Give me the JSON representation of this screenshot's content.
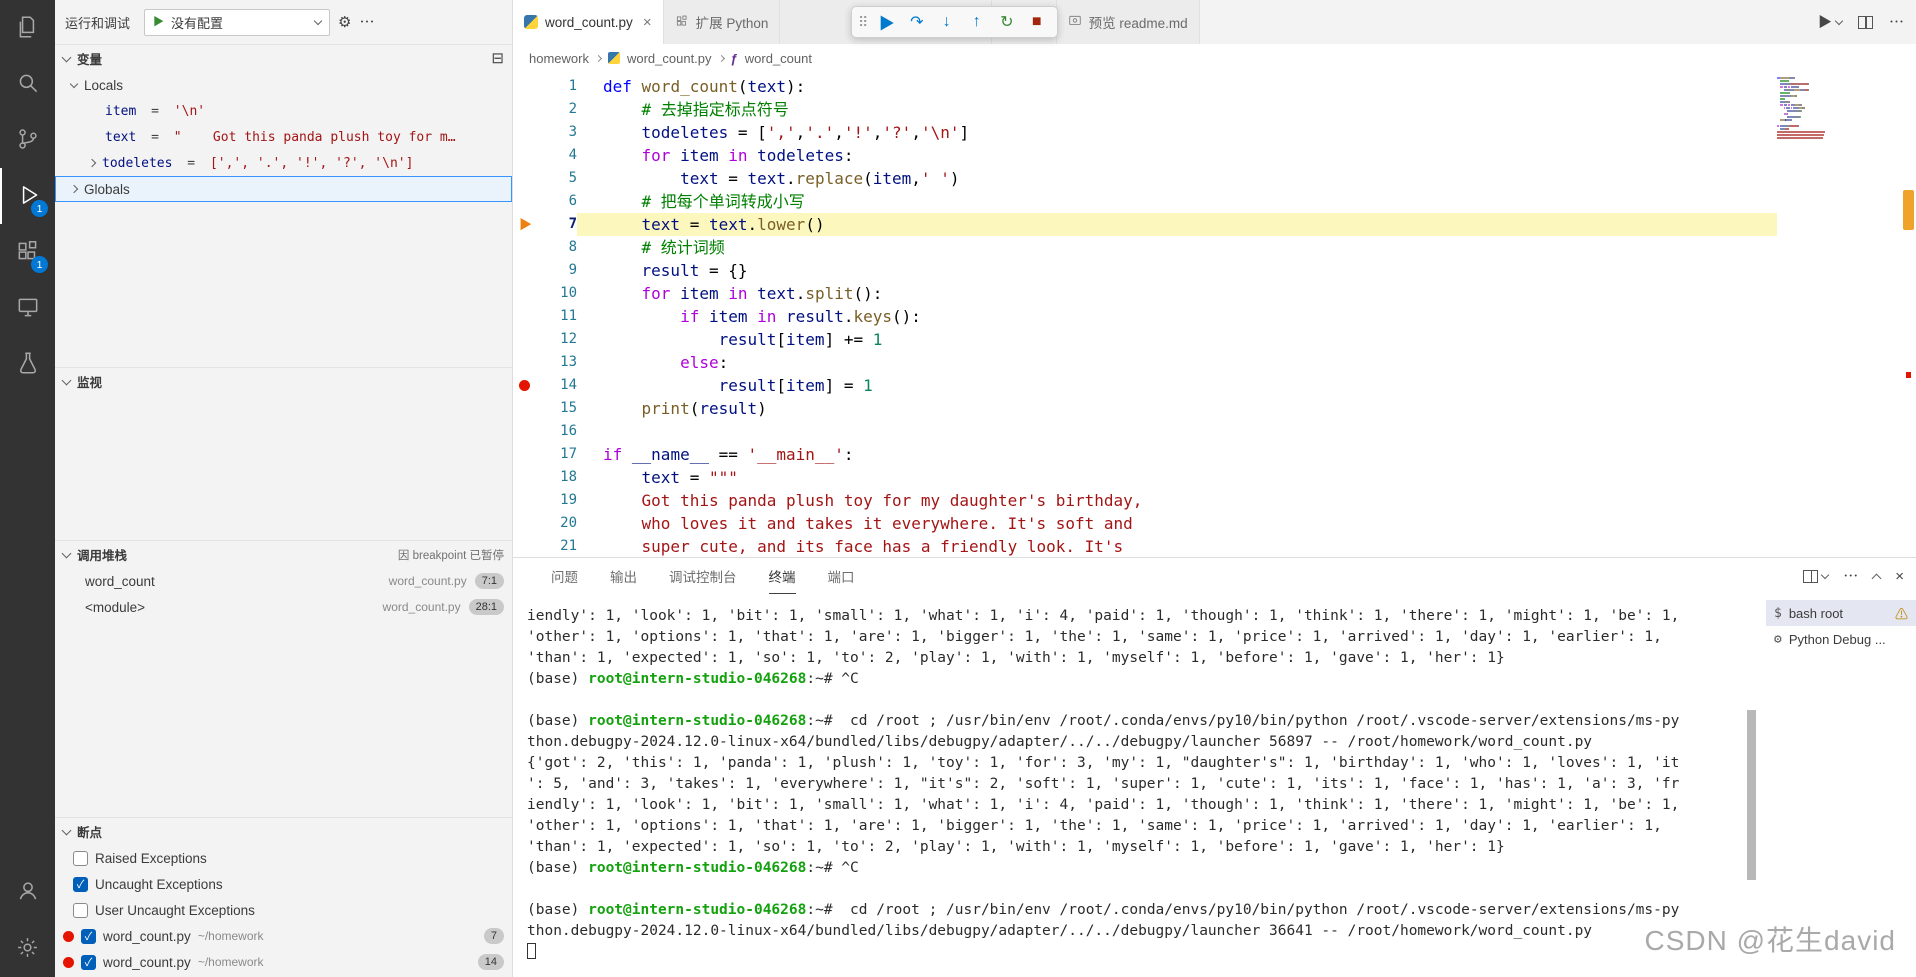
{
  "glyphs": {
    "run": "▶",
    "gear": "⚙",
    "more": "⋯",
    "close": "×",
    "check": "✓",
    "warning": "⚠",
    "grip": "⠿",
    "continue": "▶",
    "step_over": "↷",
    "step_into": "↓",
    "step_out": "↑",
    "restart": "↻",
    "stop": "■",
    "collapse": "⊟",
    "func": "ƒ",
    "dollar": "$"
  },
  "colors": {
    "accent_blue": "#0078d4",
    "breakpoint_red": "#e51400",
    "current_line_yellow": "#fcf8bd",
    "terminal_green": "#13a10e",
    "activity_bar_bg": "#333333",
    "sidebar_bg": "#f3f3f3"
  },
  "activity_bar": {
    "items": [
      {
        "id": "explorer"
      },
      {
        "id": "search"
      },
      {
        "id": "source-control"
      },
      {
        "id": "run-debug",
        "active": true,
        "badge": "1"
      },
      {
        "id": "extensions",
        "badge": "1"
      },
      {
        "id": "remote-explorer"
      },
      {
        "id": "testing"
      }
    ],
    "bottom_items": [
      {
        "id": "account"
      },
      {
        "id": "settings"
      }
    ]
  },
  "sidebar": {
    "title": "运行和调试",
    "run_button_config": "没有配置",
    "variables": {
      "title": "变量",
      "scopes": [
        {
          "label": "Locals",
          "expanded": true
        },
        {
          "label": "Globals",
          "expanded": false
        }
      ],
      "locals": [
        {
          "name": "item",
          "sep": " = ",
          "value": "'\\n'"
        },
        {
          "name": "text",
          "sep": " = ",
          "value": "\"    Got this panda plush toy for m…"
        },
        {
          "name": "todeletes",
          "sep": " = ",
          "value": "[',', '.', '!', '?', '\\n']"
        }
      ]
    },
    "watch": {
      "title": "监视"
    },
    "call_stack": {
      "title": "调用堆栈",
      "status": "因 breakpoint 已暂停",
      "frames": [
        {
          "name": "word_count",
          "file": "word_count.py",
          "pos": "7:1"
        },
        {
          "name": "<module>",
          "file": "word_count.py",
          "pos": "28:1"
        }
      ]
    },
    "breakpoints": {
      "title": "断点",
      "exceptions": [
        {
          "label": "Raised Exceptions",
          "checked": false
        },
        {
          "label": "Uncaught Exceptions",
          "checked": true
        },
        {
          "label": "User Uncaught Exceptions",
          "checked": false
        }
      ],
      "items": [
        {
          "file": "word_count.py",
          "path": "~/homework",
          "line": "7",
          "checked": true
        },
        {
          "file": "word_count.py",
          "path": "~/homework",
          "line": "14",
          "checked": true
        }
      ]
    }
  },
  "editor": {
    "tabs": [
      {
        "label": "word_count.py",
        "active": true
      },
      {
        "label": "扩展 Python",
        "active": false
      },
      {
        "label": ".md",
        "active": false
      },
      {
        "label": "预览 readme.md",
        "active": false
      }
    ],
    "breadcrumb": {
      "items": [
        "homework",
        "word_count.py",
        "word_count"
      ]
    },
    "current_line": 7,
    "breakpoint_line": 14,
    "code_lines": [
      [
        [
          "k",
          "def"
        ],
        [
          "p",
          " "
        ],
        [
          "f",
          "word_count"
        ],
        [
          "p",
          "("
        ],
        [
          "v",
          "text"
        ],
        [
          "p",
          "):"
        ]
      ],
      [
        [
          "p",
          "    "
        ],
        [
          "m",
          "# 去掉指定标点符号"
        ]
      ],
      [
        [
          "p",
          "    "
        ],
        [
          "v",
          "todeletes"
        ],
        [
          "p",
          " = ["
        ],
        [
          "s",
          "','"
        ],
        [
          "p",
          ","
        ],
        [
          "s",
          "'.'"
        ],
        [
          "p",
          ","
        ],
        [
          "s",
          "'!'"
        ],
        [
          "p",
          ","
        ],
        [
          "s",
          "'?'"
        ],
        [
          "p",
          ","
        ],
        [
          "s",
          "'\\n'"
        ],
        [
          "p",
          "]"
        ]
      ],
      [
        [
          "p",
          "    "
        ],
        [
          "c",
          "for"
        ],
        [
          "p",
          " "
        ],
        [
          "v",
          "item"
        ],
        [
          "p",
          " "
        ],
        [
          "c",
          "in"
        ],
        [
          "p",
          " "
        ],
        [
          "v",
          "todeletes"
        ],
        [
          "p",
          ":"
        ]
      ],
      [
        [
          "p",
          "        "
        ],
        [
          "v",
          "text"
        ],
        [
          "p",
          " = "
        ],
        [
          "v",
          "text"
        ],
        [
          "p",
          "."
        ],
        [
          "f",
          "replace"
        ],
        [
          "p",
          "("
        ],
        [
          "v",
          "item"
        ],
        [
          "p",
          ","
        ],
        [
          "s",
          "' '"
        ],
        [
          "p",
          ")"
        ]
      ],
      [
        [
          "p",
          "    "
        ],
        [
          "m",
          "# 把每个单词转成小写"
        ]
      ],
      [
        [
          "p",
          "    "
        ],
        [
          "v",
          "text"
        ],
        [
          "p",
          " = "
        ],
        [
          "v",
          "text"
        ],
        [
          "p",
          "."
        ],
        [
          "f",
          "lower"
        ],
        [
          "p",
          "()"
        ]
      ],
      [
        [
          "p",
          "    "
        ],
        [
          "m",
          "# 统计词频"
        ]
      ],
      [
        [
          "p",
          "    "
        ],
        [
          "v",
          "result"
        ],
        [
          "p",
          " = {}"
        ]
      ],
      [
        [
          "p",
          "    "
        ],
        [
          "c",
          "for"
        ],
        [
          "p",
          " "
        ],
        [
          "v",
          "item"
        ],
        [
          "p",
          " "
        ],
        [
          "c",
          "in"
        ],
        [
          "p",
          " "
        ],
        [
          "v",
          "text"
        ],
        [
          "p",
          "."
        ],
        [
          "f",
          "split"
        ],
        [
          "p",
          "():"
        ]
      ],
      [
        [
          "p",
          "        "
        ],
        [
          "c",
          "if"
        ],
        [
          "p",
          " "
        ],
        [
          "v",
          "item"
        ],
        [
          "p",
          " "
        ],
        [
          "c",
          "in"
        ],
        [
          "p",
          " "
        ],
        [
          "v",
          "result"
        ],
        [
          "p",
          "."
        ],
        [
          "f",
          "keys"
        ],
        [
          "p",
          "():"
        ]
      ],
      [
        [
          "p",
          "            "
        ],
        [
          "v",
          "result"
        ],
        [
          "p",
          "["
        ],
        [
          "v",
          "item"
        ],
        [
          "p",
          "] += "
        ],
        [
          "n",
          "1"
        ]
      ],
      [
        [
          "p",
          "        "
        ],
        [
          "c",
          "else"
        ],
        [
          "p",
          ":"
        ]
      ],
      [
        [
          "p",
          "            "
        ],
        [
          "v",
          "result"
        ],
        [
          "p",
          "["
        ],
        [
          "v",
          "item"
        ],
        [
          "p",
          "] = "
        ],
        [
          "n",
          "1"
        ]
      ],
      [
        [
          "p",
          "    "
        ],
        [
          "f",
          "print"
        ],
        [
          "p",
          "("
        ],
        [
          "v",
          "result"
        ],
        [
          "p",
          ")"
        ]
      ],
      [],
      [
        [
          "c",
          "if"
        ],
        [
          "p",
          " "
        ],
        [
          "v",
          "__name__"
        ],
        [
          "p",
          " == "
        ],
        [
          "s",
          "'__main__'"
        ],
        [
          "p",
          ":"
        ]
      ],
      [
        [
          "p",
          "    "
        ],
        [
          "v",
          "text"
        ],
        [
          "p",
          " = "
        ],
        [
          "s",
          "\"\"\""
        ]
      ],
      [
        [
          "s",
          "    Got this panda plush toy for my daughter's birthday,"
        ]
      ],
      [
        [
          "s",
          "    who loves it and takes it everywhere. It's soft and"
        ]
      ],
      [
        [
          "s",
          "    super cute, and its face has a friendly look. It's"
        ]
      ]
    ]
  },
  "panel": {
    "tabs": [
      {
        "label": "问题",
        "active": false
      },
      {
        "label": "输出",
        "active": false
      },
      {
        "label": "调试控制台",
        "active": false
      },
      {
        "label": "终端",
        "active": true
      },
      {
        "label": "端口",
        "active": false
      }
    ],
    "terminal_lines": [
      [
        [
          "t",
          "iendly': 1, 'look': 1, 'bit': 1, 'small': 1, 'what': 1, 'i': 4, 'paid': 1, 'though': 1, 'think': 1, 'there': 1, 'might': 1, 'be': 1,"
        ]
      ],
      [
        [
          "t",
          "'other': 1, 'options': 1, 'that': 1, 'are': 1, 'bigger': 1, 'the': 1, 'same': 1, 'price': 1, 'arrived': 1, 'day': 1, 'earlier': 1,"
        ]
      ],
      [
        [
          "t",
          "'than': 1, 'expected': 1, 'so': 1, 'to': 2, 'play': 1, 'with': 1, 'myself': 1, 'before': 1, 'gave': 1, 'her': 1}"
        ]
      ],
      [
        [
          "t",
          "(base) "
        ],
        [
          "g",
          "root@intern-studio-046268"
        ],
        [
          "t",
          ":~# ^C"
        ]
      ],
      [],
      [
        [
          "t",
          "(base) "
        ],
        [
          "g",
          "root@intern-studio-046268"
        ],
        [
          "t",
          ":~#  cd /root ; /usr/bin/env /root/.conda/envs/py10/bin/python /root/.vscode-server/extensions/ms-py"
        ]
      ],
      [
        [
          "t",
          "thon.debugpy-2024.12.0-linux-x64/bundled/libs/debugpy/adapter/../../debugpy/launcher 56897 -- /root/homework/word_count.py"
        ]
      ],
      [
        [
          "t",
          "{'got': 2, 'this': 1, 'panda': 1, 'plush': 1, 'toy': 1, 'for': 3, 'my': 1, \"daughter's\": 1, 'birthday': 1, 'who': 1, 'loves': 1, 'it"
        ]
      ],
      [
        [
          "t",
          "': 5, 'and': 3, 'takes': 1, 'everywhere': 1, \"it's\": 2, 'soft': 1, 'super': 1, 'cute': 1, 'its': 1, 'face': 1, 'has': 1, 'a': 3, 'fr"
        ]
      ],
      [
        [
          "t",
          "iendly': 1, 'look': 1, 'bit': 1, 'small': 1, 'what': 1, 'i': 4, 'paid': 1, 'though': 1, 'think': 1, 'there': 1, 'might': 1, 'be': 1,"
        ]
      ],
      [
        [
          "t",
          "'other': 1, 'options': 1, 'that': 1, 'are': 1, 'bigger': 1, 'the': 1, 'same': 1, 'price': 1, 'arrived': 1, 'day': 1, 'earlier': 1,"
        ]
      ],
      [
        [
          "t",
          "'than': 1, 'expected': 1, 'so': 1, 'to': 2, 'play': 1, 'with': 1, 'myself': 1, 'before': 1, 'gave': 1, 'her': 1}"
        ]
      ],
      [
        [
          "t",
          "(base) "
        ],
        [
          "g",
          "root@intern-studio-046268"
        ],
        [
          "t",
          ":~# ^C"
        ]
      ],
      [],
      [
        [
          "t",
          "(base) "
        ],
        [
          "g",
          "root@intern-studio-046268"
        ],
        [
          "t",
          ":~#  cd /root ; /usr/bin/env /root/.conda/envs/py10/bin/python /root/.vscode-server/extensions/ms-py"
        ]
      ],
      [
        [
          "t",
          "thon.debugpy-2024.12.0-linux-x64/bundled/libs/debugpy/adapter/../../debugpy/launcher 36641 -- /root/homework/word_count.py"
        ]
      ],
      [
        [
          "cursor",
          ""
        ]
      ]
    ],
    "terminal_list": [
      {
        "label": "bash root",
        "warning": true
      },
      {
        "label": "Python Debug ...",
        "warning": false
      }
    ]
  },
  "watermark": "CSDN @花生david"
}
